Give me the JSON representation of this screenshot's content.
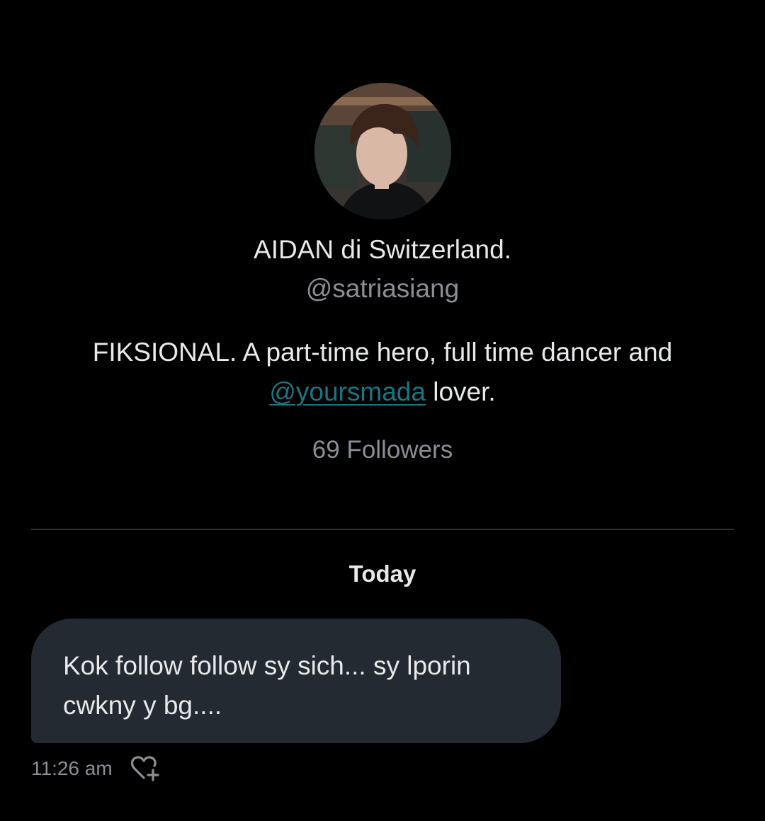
{
  "profile": {
    "avatar_alt": "profile-photo",
    "display_name": "AIDAN di Switzerland.",
    "handle": "@satriasiang",
    "bio_before": "FIKSIONAL.   A part-time hero, full time dancer and ",
    "bio_mention": "@yoursmada",
    "bio_after": " lover.",
    "followers": "69 Followers"
  },
  "conversation": {
    "date_separator": "Today",
    "messages": [
      {
        "text": "Kok follow follow sy sich...  sy lporin cwkny y bg....",
        "time": "11:26 am",
        "reaction_icon": "add-reaction-heart-icon"
      }
    ]
  },
  "colors": {
    "background": "#000000",
    "text_primary": "#e7e9ea",
    "text_secondary": "#8b8f94",
    "mention": "#1d7480",
    "bubble": "#232a31",
    "divider": "#2f3336"
  }
}
